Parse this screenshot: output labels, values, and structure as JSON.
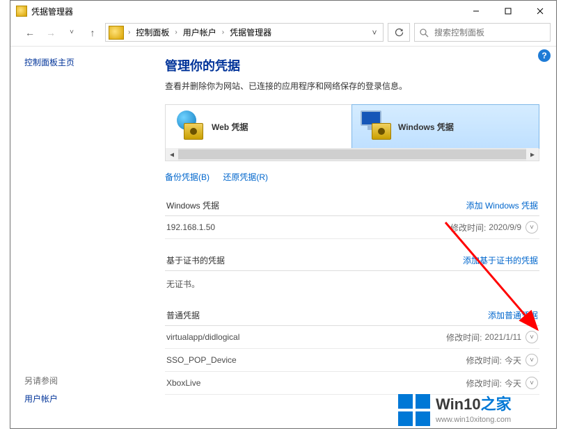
{
  "window": {
    "title": "凭据管理器"
  },
  "breadcrumbs": {
    "items": [
      "控制面板",
      "用户帐户",
      "凭据管理器"
    ]
  },
  "search": {
    "placeholder": "搜索控制面板"
  },
  "sidebar": {
    "heading": "控制面板主页",
    "see_also": "另请参阅",
    "link": "用户帐户"
  },
  "main": {
    "title": "管理你的凭据",
    "description": "查看并删除你为网站、已连接的应用程序和网络保存的登录信息。"
  },
  "tabs": {
    "web": "Web 凭据",
    "windows": "Windows 凭据"
  },
  "actions": {
    "backup": "备份凭据(B)",
    "restore": "还原凭据(R)"
  },
  "sections": {
    "windows": {
      "title": "Windows 凭据",
      "add": "添加 Windows 凭据"
    },
    "cert": {
      "title": "基于证书的凭据",
      "add": "添加基于证书的凭据",
      "empty": "无证书。"
    },
    "generic": {
      "title": "普通凭据",
      "add": "添加普通凭据"
    }
  },
  "modified_label": "修改时间:",
  "credentials": {
    "windows": [
      {
        "name": "192.168.1.50",
        "date": "2020/9/9"
      }
    ],
    "generic": [
      {
        "name": "virtualapp/didlogical",
        "date": "2021/1/11"
      },
      {
        "name": "SSO_POP_Device",
        "date": "今天"
      },
      {
        "name": "XboxLive",
        "date": "今天"
      }
    ]
  },
  "watermark": {
    "brand_left": "Win10",
    "brand_right": "之家",
    "url": "www.win10xitong.com"
  }
}
